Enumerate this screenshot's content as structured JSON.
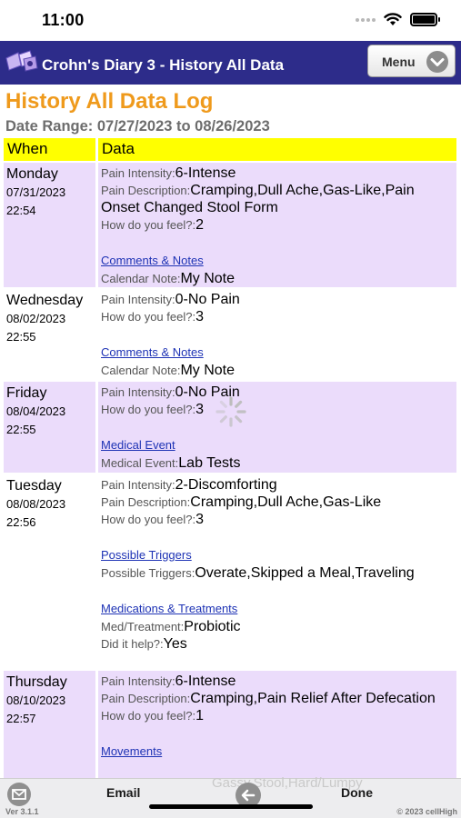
{
  "status_bar": {
    "time": "11:00"
  },
  "nav": {
    "title": "Crohn's Diary 3 - History All Data",
    "menu_label": "Menu"
  },
  "page": {
    "title": "History All Data Log",
    "date_range": "Date Range: 07/27/2023 to 08/26/2023"
  },
  "table": {
    "headers": {
      "when": "When",
      "data": "Data"
    },
    "rows": [
      {
        "day": "Monday",
        "date": "07/31/2023",
        "time": "22:54",
        "pain_intensity_label": "Pain Intensity:",
        "pain_intensity": "6-Intense",
        "pain_description_label": "Pain Description:",
        "pain_description": "Cramping,Dull Ache,Gas-Like,Pain Onset Changed Stool Form",
        "feel_label": "How do you feel?:",
        "feel": "2",
        "link": "Comments & Notes",
        "extra_label": "Calendar Note:",
        "extra_value": "My Note"
      },
      {
        "day": "Wednesday",
        "date": "08/02/2023",
        "time": "22:55",
        "pain_intensity_label": "Pain Intensity:",
        "pain_intensity": "0-No Pain",
        "feel_label": "How do you feel?:",
        "feel": "3",
        "link": "Comments & Notes",
        "extra_label": "Calendar Note:",
        "extra_value": "My Note"
      },
      {
        "day": "Friday",
        "date": "08/04/2023",
        "time": "22:55",
        "pain_intensity_label": "Pain Intensity:",
        "pain_intensity": "0-No Pain",
        "feel_label": "How do you feel?:",
        "feel": "3",
        "link": "Medical Event",
        "extra_label": "Medical Event:",
        "extra_value": "Lab Tests"
      },
      {
        "day": "Tuesday",
        "date": "08/08/2023",
        "time": "22:56",
        "pain_intensity_label": "Pain Intensity:",
        "pain_intensity": "2-Discomforting",
        "pain_description_label": "Pain Description:",
        "pain_description": "Cramping,Dull Ache,Gas-Like",
        "feel_label": "How do you feel?:",
        "feel": "3",
        "link": "Possible Triggers",
        "triggers_label": "Possible Triggers:",
        "triggers": "Overate,Skipped a Meal,Traveling",
        "link2": "Medications & Treatments",
        "med_label": "Med/Treatment:",
        "med": "Probiotic",
        "help_label": "Did it help?:",
        "help": "Yes"
      },
      {
        "day": "Thursday",
        "date": "08/10/2023",
        "time": "22:57",
        "pain_intensity_label": "Pain Intensity:",
        "pain_intensity": "6-Intense",
        "pain_description_label": "Pain Description:",
        "pain_description": "Cramping,Pain Relief After Defecation",
        "feel_label": "How do you feel?:",
        "feel": "1",
        "link": "Movements",
        "movement_value": "Gassy,Stool,Hard/Lumpy"
      }
    ]
  },
  "toolbar": {
    "email_label": "Email",
    "done_label": "Done",
    "version": "Ver 3.1.1",
    "copyright": "© 2023 cellHigh"
  },
  "colors": {
    "nav_bar": "#2d2c8a",
    "title_orange": "#ef9a1c",
    "header_yellow": "#ffff00",
    "row_shade": "#ebdcfb",
    "link_blue": "#1e33b5"
  },
  "icons": [
    "wifi-icon",
    "battery-icon",
    "app-logo-icon",
    "chevron-down-icon",
    "email-icon",
    "back-arrow-icon",
    "spinner-icon"
  ]
}
